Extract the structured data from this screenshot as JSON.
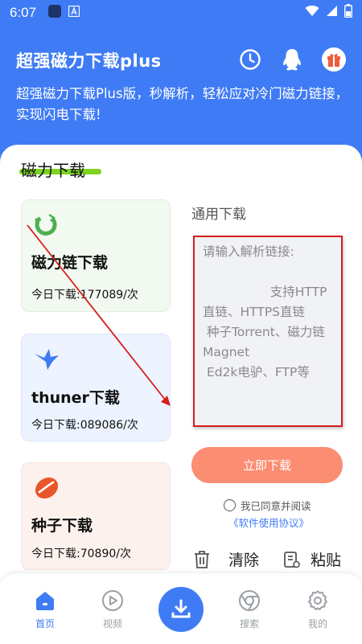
{
  "status_bar": {
    "time": "6:07"
  },
  "header": {
    "title": "超强磁力下载plus",
    "subtitle": "超强磁力下载Plus版，秒解析，轻松应对冷门磁力链接，实现闪电下载!"
  },
  "section": {
    "title": "磁力下载"
  },
  "cards": [
    {
      "title": "磁力链下载",
      "sub": "今日下载:177089/次"
    },
    {
      "title": "thuner下载",
      "sub": "今日下载:089086/次"
    },
    {
      "title": "种子下载",
      "sub": "今日下载:70890/次"
    }
  ],
  "download_panel": {
    "label": "通用下载",
    "placeholder": "请输入解析链接:\n\n                 支持HTTP直链、HTTPS直链\n 种子Torrent、磁力链Magnet\n Ed2k电驴、FTP等",
    "button": "立即下载",
    "agree_text": "我已同意并阅读",
    "agreement_link": "《软件使用协议》",
    "clear_label": "清除",
    "paste_label": "粘贴"
  },
  "nav": {
    "items": [
      {
        "label": "首页"
      },
      {
        "label": "视频"
      },
      {
        "label": "搜索"
      },
      {
        "label": "我的"
      }
    ]
  },
  "colors": {
    "primary": "#3f7bf5",
    "accent_button": "#fb8d72",
    "highlight": "#7ed321",
    "annotation": "#d61f1f"
  }
}
